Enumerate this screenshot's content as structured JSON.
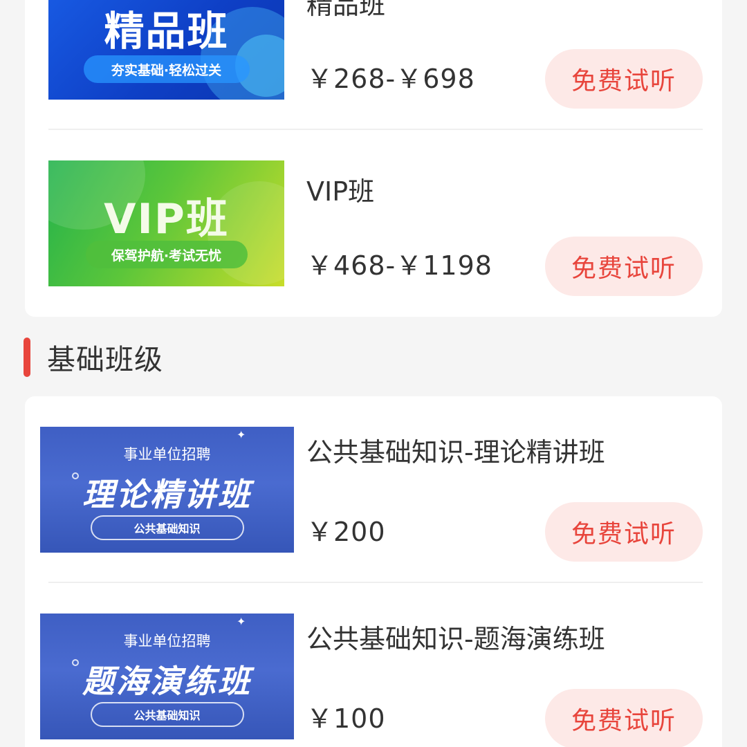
{
  "colors": {
    "accent": "#e8453c",
    "trial_button_bg": "#fde9e7",
    "page_bg": "#f5f5f5",
    "card_bg": "#ffffff"
  },
  "top_courses": [
    {
      "title": "精品班",
      "price": "￥268-￥698",
      "trial_label": "免费试听",
      "thumb": {
        "main_text": "精品班",
        "sub_text": "夯实基础·轻松过关"
      }
    },
    {
      "title": "VIP班",
      "price": "￥468-￥1198",
      "trial_label": "免费试听",
      "thumb": {
        "main_text": "VIP班",
        "sub_text": "保驾护航·考试无忧"
      }
    }
  ],
  "basic_section": {
    "title": "基础班级",
    "courses": [
      {
        "title": "公共基础知识-理论精讲班",
        "price": "￥200",
        "trial_label": "免费试听",
        "thumb": {
          "top_text": "事业单位招聘",
          "main_text": "理论精讲班",
          "sub_text": "公共基础知识"
        }
      },
      {
        "title": "公共基础知识-题海演练班",
        "price": "￥100",
        "trial_label": "免费试听",
        "thumb": {
          "top_text": "事业单位招聘",
          "main_text": "题海演练班",
          "sub_text": "公共基础知识"
        }
      }
    ]
  }
}
